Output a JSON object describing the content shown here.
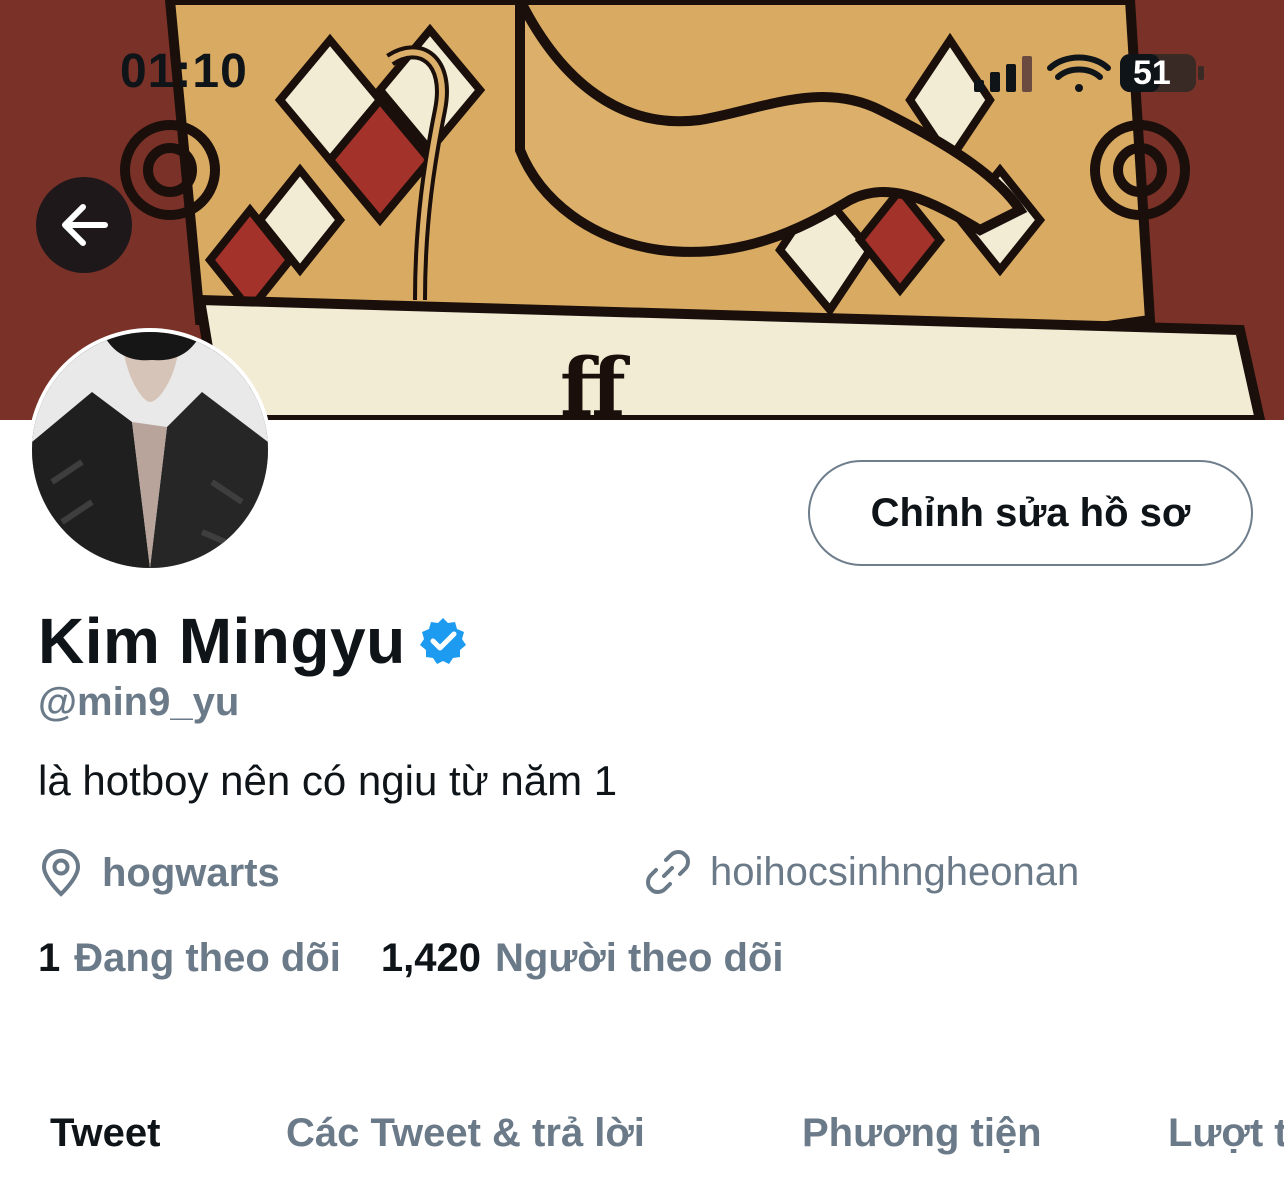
{
  "status_bar": {
    "time": "01:10",
    "battery": "51"
  },
  "header": {
    "back_icon": "arrow-left-icon"
  },
  "profile": {
    "name": "Kim Mingyu",
    "handle": "@min9_yu",
    "bio": "là hotboy nên có ngiu từ năm 1",
    "location": "hogwarts",
    "website": "hoihocsinhngheonan",
    "following_count": "1",
    "following_label": "Đang theo dõi",
    "followers_count": "1,420",
    "followers_label": "Người theo dõi",
    "edit_button_label": "Chỉnh sửa hồ sơ"
  },
  "tabs": [
    {
      "label": "Tweet",
      "active": true
    },
    {
      "label": "Các Tweet & trả lời",
      "active": false
    },
    {
      "label": "Phương tiện",
      "active": false
    },
    {
      "label": "Lượt t",
      "active": false
    }
  ],
  "colors": {
    "accent": "#1d9bf0",
    "banner": "#7a3128",
    "muted": "#6b7a88"
  }
}
